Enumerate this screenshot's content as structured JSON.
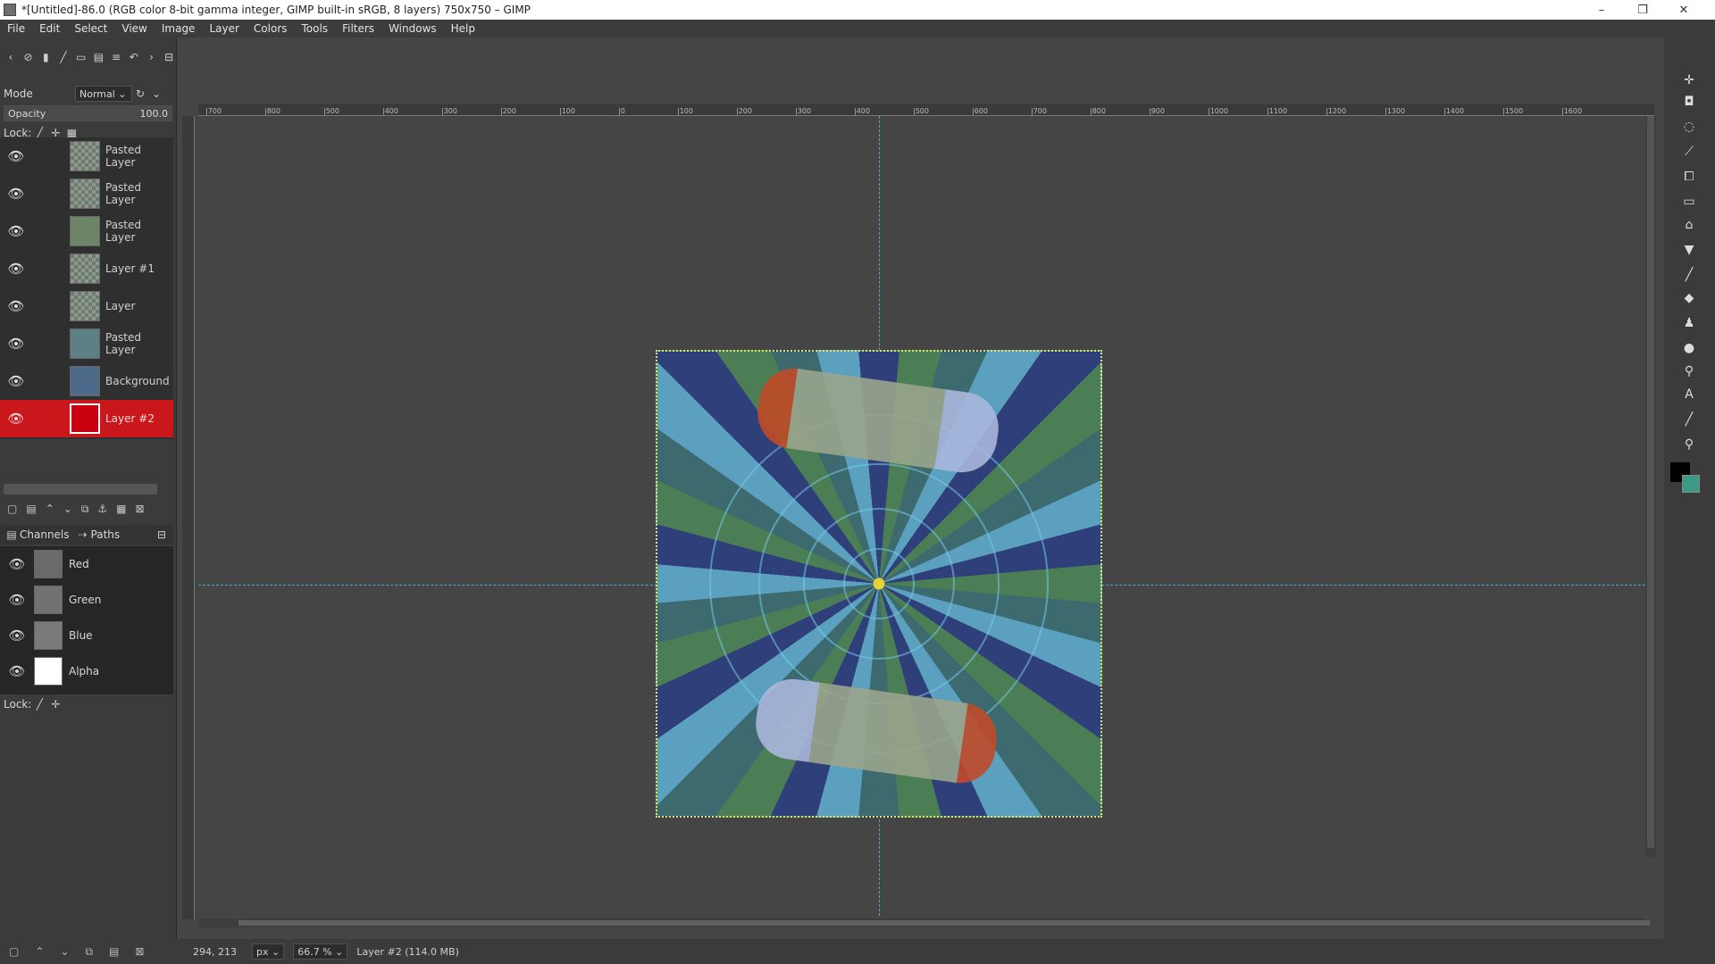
{
  "window": {
    "title": "*[Untitled]-86.0 (RGB color 8-bit gamma integer, GIMP built-in sRGB, 8 layers) 750x750 – GIMP",
    "minimize": "–",
    "maximize": "❐",
    "close": "✕"
  },
  "menubar": [
    "File",
    "Edit",
    "Select",
    "View",
    "Image",
    "Layer",
    "Colors",
    "Tools",
    "Filters",
    "Windows",
    "Help"
  ],
  "layers_panel": {
    "mode_label": "Mode",
    "mode_value": "Normal",
    "opacity_label": "Opacity",
    "opacity_value": "100.0",
    "lock_label": "Lock:",
    "layers": [
      {
        "name": "Pasted Layer",
        "visible": true,
        "active": false
      },
      {
        "name": "Pasted Layer",
        "visible": true,
        "active": false
      },
      {
        "name": "Pasted Layer",
        "visible": true,
        "active": false
      },
      {
        "name": "Layer #1",
        "visible": true,
        "active": false
      },
      {
        "name": "Layer",
        "visible": true,
        "active": false
      },
      {
        "name": "Pasted Layer",
        "visible": true,
        "active": false
      },
      {
        "name": "Background",
        "visible": true,
        "active": false
      },
      {
        "name": "Layer #2",
        "visible": true,
        "active": true
      }
    ]
  },
  "channels_panel": {
    "tab_channels": "Channels",
    "tab_paths": "Paths",
    "channels": [
      "Red",
      "Green",
      "Blue",
      "Alpha"
    ],
    "lock_label": "Lock:"
  },
  "ruler_ticks": [
    "|700",
    "|800",
    "|500",
    "|400",
    "|300",
    "|200",
    "|100",
    "|0",
    "|100",
    "|200",
    "|300",
    "|400",
    "|500",
    "|600",
    "|700",
    "|800",
    "|900",
    "|1000",
    "|1100",
    "|1200",
    "|1300",
    "|1400",
    "|1500",
    "|1600"
  ],
  "status": {
    "coords": "294, 213",
    "unit": "px",
    "zoom": "66.7 %",
    "layer_info": "Layer #2 (114.0 MB)"
  },
  "colors": {
    "active_layer": "#c9171c",
    "guide": "#4aa7c7",
    "foreground": "#000000",
    "background": "#3a9a86"
  }
}
